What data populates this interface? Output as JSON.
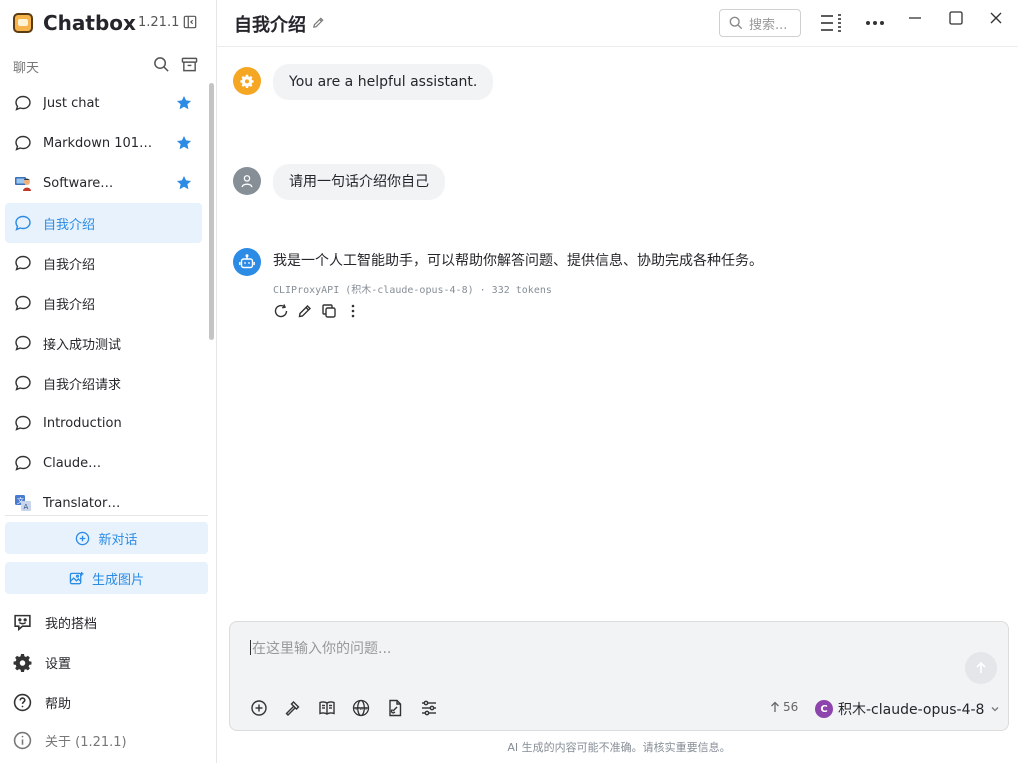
{
  "app": {
    "name": "Chatbox",
    "version": "1.21.1"
  },
  "sidebar": {
    "section_label": "聊天",
    "chats": [
      {
        "label": "Just chat",
        "icon": "chat-bubble-icon",
        "starred": true
      },
      {
        "label": "Markdown 101…",
        "icon": "chat-bubble-icon",
        "starred": true
      },
      {
        "label": "Software…",
        "icon": "developer-avatar-icon",
        "starred": true
      },
      {
        "label": "自我介绍",
        "icon": "chat-bubble-icon",
        "starred": false,
        "active": true
      },
      {
        "label": "自我介绍",
        "icon": "chat-bubble-icon",
        "starred": false
      },
      {
        "label": "自我介绍",
        "icon": "chat-bubble-icon",
        "starred": false
      },
      {
        "label": "接入成功测试",
        "icon": "chat-bubble-icon",
        "starred": false
      },
      {
        "label": "自我介绍请求",
        "icon": "chat-bubble-icon",
        "starred": false
      },
      {
        "label": "Introduction",
        "icon": "chat-bubble-icon",
        "starred": false
      },
      {
        "label": "Claude…",
        "icon": "chat-bubble-icon",
        "starred": false
      },
      {
        "label": "Translator…",
        "icon": "translator-avatar-icon",
        "starred": false
      }
    ],
    "new_chat_label": "新对话",
    "new_image_label": "生成图片",
    "bottom": {
      "profile_label": "我的搭档",
      "settings_label": "设置",
      "help_label": "帮助",
      "about_label": "关于 (1.21.1)"
    }
  },
  "header": {
    "title": "自我介绍",
    "search_placeholder": "搜索..."
  },
  "messages": {
    "system": "You are a helpful assistant.",
    "user": "请用一句话介绍你自己",
    "assistant": "我是一个人工智能助手，可以帮助你解答问题、提供信息、协助完成各种任务。",
    "assistant_meta": "CLIProxyAPI (积木-claude-opus-4-8) · 332 tokens"
  },
  "composer": {
    "placeholder": "在这里输入你的问题...",
    "token_count": "56",
    "model_initial": "C",
    "model_name": "积木-claude-opus-4-8"
  },
  "disclaimer": "AI 生成的内容可能不准确。请核实重要信息。",
  "colors": {
    "accent": "#2b8be5",
    "active_bg": "#e7f2fc",
    "system_avatar": "#f5a623",
    "user_avatar": "#868e96",
    "model_avatar": "#8e44ad"
  }
}
